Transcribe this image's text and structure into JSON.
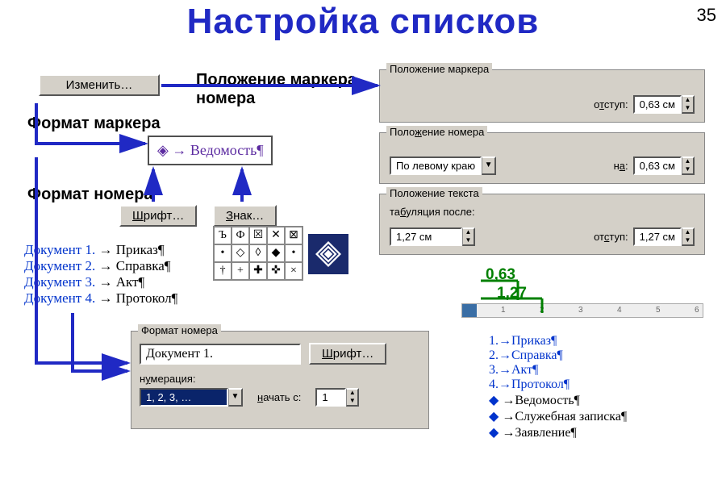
{
  "page_number": "35",
  "title": "Настройка списков",
  "edit_button": "Изменить…",
  "caption_marker_pos": "Положение маркера, номера",
  "caption_format_marker": "Формат маркера",
  "caption_format_number": "Формат номера",
  "font_button": "Шрифт…",
  "sign_button": "Знак…",
  "font_button2": "Шрифт…",
  "sample_bullet": "◈ → Ведомость¶",
  "doc_list": [
    {
      "num": "Документ 1.",
      "txt": " → Приказ¶"
    },
    {
      "num": "Документ 2.",
      "txt": " → Справка¶"
    },
    {
      "num": "Документ 3.",
      "txt": " → Акт¶"
    },
    {
      "num": "Документ 4.",
      "txt": " → Протокол¶"
    }
  ],
  "group_marker": {
    "title": "Положение маркера",
    "indent_label_pre": "о",
    "indent_label_u": "т",
    "indent_label_post": "ступ:",
    "indent_value": "0,63 см"
  },
  "group_number": {
    "title_pre": "Поло",
    "title_u": "ж",
    "title_post": "ение номера",
    "align_value": "По левому краю",
    "at_label_pre": "н",
    "at_label_u": "а",
    "at_label_post": ":",
    "at_value": "0,63 см"
  },
  "group_text": {
    "title": "Положение текста",
    "tab_label_pre": "та",
    "tab_label_u": "б",
    "tab_label_post": "уляция после:",
    "tab_value": "1,27 см",
    "ind_label_pre": "от",
    "ind_label_u": "с",
    "ind_label_post": "туп:",
    "ind_value": "1,27 см"
  },
  "format_group": {
    "title": "Формат номера",
    "value": "Документ 1.",
    "num_label_pre": "н",
    "num_label_u": "у",
    "num_label_post": "мерация:",
    "num_value": "1, 2, 3, …",
    "start_label_pre": "",
    "start_label_u": "н",
    "start_label_post": "ачать с:",
    "start_value": "1"
  },
  "measure_063": "0,63",
  "measure_127": "1,27",
  "num_list": [
    "1.→Приказ¶",
    "2.→Справка¶",
    "3.→Акт¶",
    "4.→Протокол¶",
    "◆→Ведомость¶",
    "◆→Служебная записка¶",
    "◆→Заявление¶"
  ]
}
